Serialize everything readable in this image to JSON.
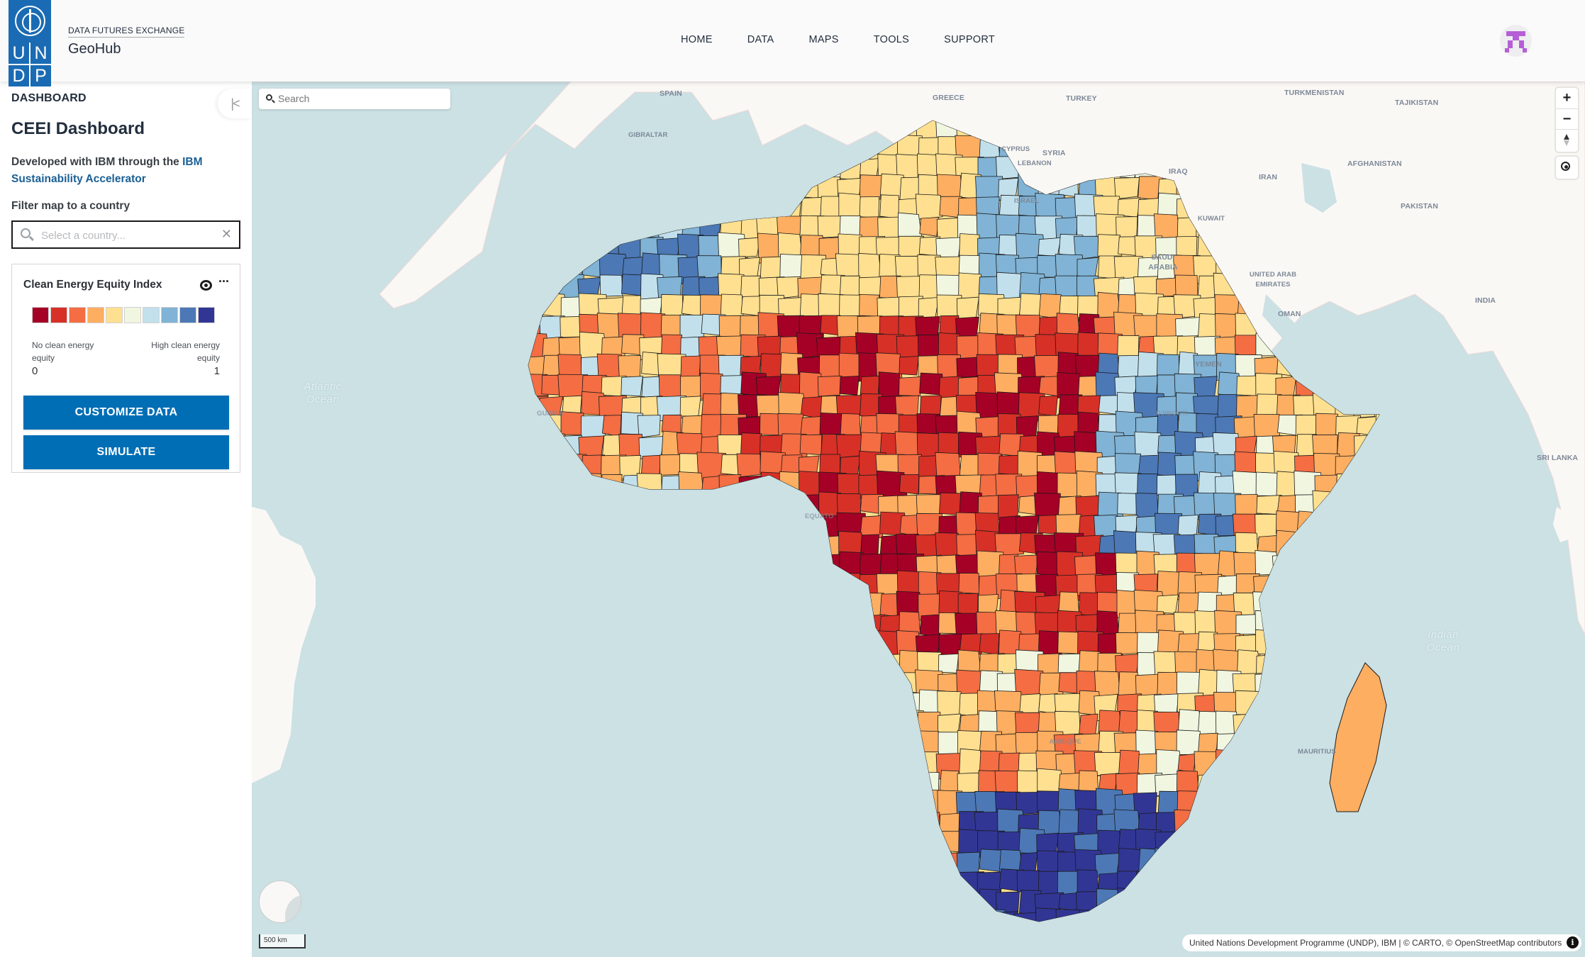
{
  "header": {
    "logo_letters": [
      "U",
      "N",
      "D",
      "P"
    ],
    "brand_sub": "DATA FUTURES EXCHANGE",
    "brand_title": "GeoHub",
    "nav": [
      "HOME",
      "DATA",
      "MAPS",
      "TOOLS",
      "SUPPORT"
    ]
  },
  "sidebar": {
    "heading": "DASHBOARD",
    "collapse_icon": "⇤",
    "title": "CEEI Dashboard",
    "description_prefix": "Developed with IBM through the ",
    "description_link": "IBM Sustainability Accelerator",
    "filter_label": "Filter map to a country",
    "country_placeholder": "Select a country...",
    "clear_icon": "✕"
  },
  "layer": {
    "title": "Clean Energy Equity Index",
    "more_icon": "···",
    "legend": {
      "colors": [
        "#a50026",
        "#d73027",
        "#f46d43",
        "#fdae61",
        "#fee090",
        "#f0f6e0",
        "#c2e0ec",
        "#80b3d5",
        "#4c78b6",
        "#313695"
      ],
      "min_label": "No clean energy equity",
      "max_label": "High clean energy equity",
      "min_value": "0",
      "max_value": "1"
    },
    "customize_button": "CUSTOMIZE DATA",
    "simulate_button": "SIMULATE"
  },
  "map": {
    "search_placeholder": "Search",
    "zoom_in": "+",
    "zoom_out": "−",
    "scale_label": "500 km",
    "attribution": "United Nations Development Programme (UNDP), IBM | © CARTO, © OpenStreetMap contributors",
    "info_icon": "i",
    "country_labels": [
      "SPAIN",
      "GREECE",
      "TURKEY",
      "TURKMENISTAN",
      "TAJIKISTAN",
      "GIBRALTAR",
      "CYPRUS",
      "SYRIA",
      "LEBANON",
      "ISRAEL",
      "IRAQ",
      "IRAN",
      "AFGHANISTAN",
      "KUWAIT",
      "PAKISTAN",
      "SAUDI ARABIA",
      "UNITED ARAB EMIRATES",
      "INDIA",
      "OMAN",
      "YEMEN",
      "DJIBOUTI",
      "SRI LANKA",
      "GUINEA",
      "EQUATORIAL GUINEA",
      "MOZAMBIQUE",
      "MAURITIUS"
    ],
    "ocean_labels": [
      "Atlantic Ocean",
      "Indian Ocean"
    ]
  }
}
